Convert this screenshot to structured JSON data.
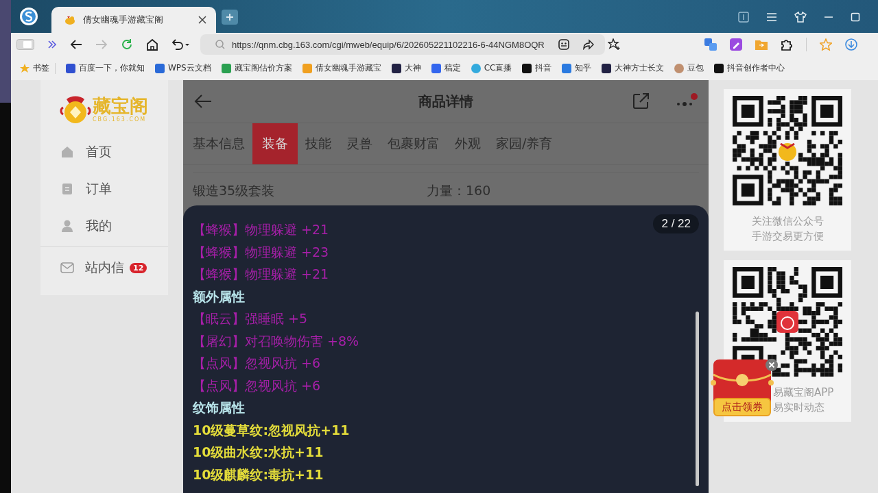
{
  "browser": {
    "tabs": [
      {
        "title": "倩女幽魂手游藏宝阁",
        "selected": true
      }
    ],
    "address": "https://qnm.cbg.163.com/cgi/mweb/equip/6/202605221102216-6-44NGM8OQR",
    "bookmarks": [
      {
        "label": "书签"
      },
      {
        "label": "百度一下，你就知"
      },
      {
        "label": "WPS云文档"
      },
      {
        "label": "藏宝阁估价方案"
      },
      {
        "label": "倩女幽魂手游藏宝"
      },
      {
        "label": "大神"
      },
      {
        "label": "稿定"
      },
      {
        "label": "CC直播"
      },
      {
        "label": "抖音"
      },
      {
        "label": "知乎"
      },
      {
        "label": "大神方士长文"
      },
      {
        "label": "豆包"
      },
      {
        "label": "抖音创作者中心"
      }
    ]
  },
  "sidebar": {
    "logo": {
      "name": "藏宝阁",
      "domain": "CBG.163.COM"
    },
    "items": [
      {
        "label": "首页"
      },
      {
        "label": "订单"
      },
      {
        "label": "我的"
      }
    ],
    "messages": {
      "label": "站内信",
      "badge": "12"
    }
  },
  "page": {
    "title": "商品详情",
    "tabs": [
      {
        "label": "基本信息",
        "selected": false
      },
      {
        "label": "装备",
        "selected": true
      },
      {
        "label": "技能",
        "selected": false
      },
      {
        "label": "灵兽",
        "selected": false
      },
      {
        "label": "包裹财富",
        "selected": false
      },
      {
        "label": "外观",
        "selected": false
      },
      {
        "label": "家园/养育",
        "selected": false
      }
    ],
    "row": {
      "left": "锻造35级套装",
      "right_label": "力量：",
      "right_value": "160"
    }
  },
  "overlay": {
    "counter": "2 / 22",
    "lines": [
      {
        "kind": "effect",
        "text": "【蜂猴】物理躲避 +21"
      },
      {
        "kind": "effect",
        "text": "【蜂猴】物理躲避 +23"
      },
      {
        "kind": "effect",
        "text": "【蜂猴】物理躲避 +21"
      },
      {
        "kind": "heading",
        "text": "额外属性"
      },
      {
        "kind": "effect",
        "text": "【眠云】强睡眠 +5"
      },
      {
        "kind": "effect",
        "text": "【屠幻】对召唤物伤害 +8%"
      },
      {
        "kind": "effect",
        "text": "【点风】忽视风抗 +6"
      },
      {
        "kind": "effect",
        "text": "【点风】忽视风抗 +6"
      },
      {
        "kind": "heading",
        "text": "纹饰属性"
      },
      {
        "kind": "ornament",
        "text": "10级蔓草纹:忽视风抗+11"
      },
      {
        "kind": "ornament",
        "text": "10级曲水纹:水抗+11"
      },
      {
        "kind": "ornament",
        "text": "10级麒麟纹:毒抗+11"
      }
    ]
  },
  "qr_cards": [
    {
      "captions": [
        "关注微信公众号",
        "手游交易更方便"
      ]
    },
    {
      "captions": [
        "易藏宝阁APP",
        "易实时动态"
      ]
    }
  ],
  "coupon": {
    "label": "点击领券"
  }
}
